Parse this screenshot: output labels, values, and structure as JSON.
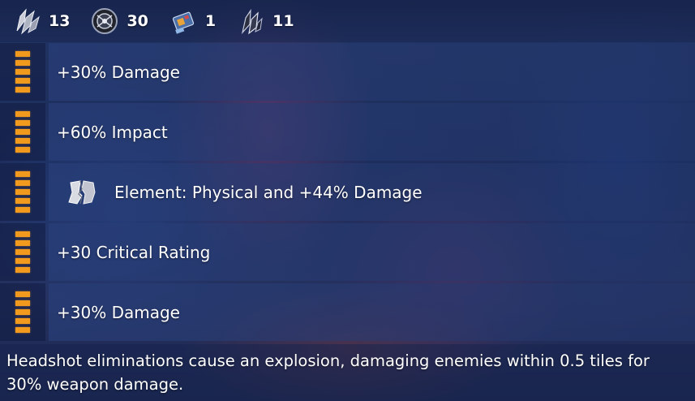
{
  "resources": [
    {
      "icon": "crystal-shard-icon",
      "count": "13"
    },
    {
      "icon": "dark-core-icon",
      "count": "30"
    },
    {
      "icon": "weapon-part-icon",
      "count": "1"
    },
    {
      "icon": "dark-crystal-icon",
      "count": "11"
    }
  ],
  "perks": [
    {
      "text": "+30% Damage"
    },
    {
      "text": "+60% Impact"
    },
    {
      "text": "Element: Physical and +44% Damage",
      "icon": "physical-element-icon"
    },
    {
      "text": "+30 Critical Rating"
    },
    {
      "text": "+30% Damage"
    }
  ],
  "description": "Headshot eliminations cause an explosion, damaging enemies within 0.5 tiles for 30% weapon damage.",
  "colors": {
    "grip_accent": "#f29a1d",
    "text": "#ffffff"
  }
}
